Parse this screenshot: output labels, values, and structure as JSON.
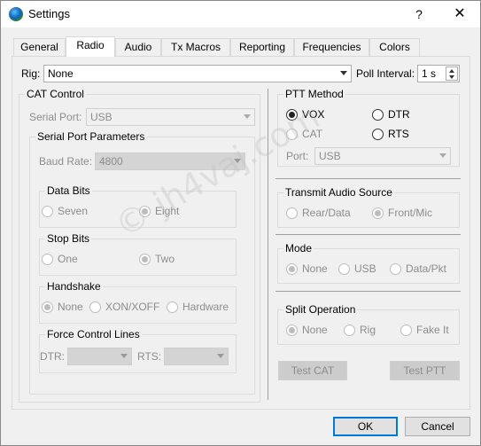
{
  "window": {
    "title": "Settings",
    "help_glyph": "?",
    "close_glyph": "✕"
  },
  "tabs": [
    "General",
    "Radio",
    "Audio",
    "Tx Macros",
    "Reporting",
    "Frequencies",
    "Colors"
  ],
  "active_tab": "Radio",
  "rig": {
    "label": "Rig:",
    "value": "None"
  },
  "poll": {
    "label": "Poll Interval:",
    "value": "1 s"
  },
  "cat": {
    "title": "CAT Control",
    "serial_port_label": "Serial Port:",
    "serial_port_value": "USB",
    "params_title": "Serial Port Parameters",
    "baud_label": "Baud Rate:",
    "baud_value": "4800",
    "data_bits": {
      "title": "Data Bits",
      "options": [
        "Seven",
        "Eight"
      ],
      "selected": "Eight"
    },
    "stop_bits": {
      "title": "Stop Bits",
      "options": [
        "One",
        "Two"
      ],
      "selected": "Two"
    },
    "handshake": {
      "title": "Handshake",
      "options": [
        "None",
        "XON/XOFF",
        "Hardware"
      ],
      "selected": "None"
    },
    "force": {
      "title": "Force Control Lines",
      "dtr_label": "DTR:",
      "rts_label": "RTS:"
    }
  },
  "ptt": {
    "title": "PTT Method",
    "options": [
      "VOX",
      "DTR",
      "CAT",
      "RTS"
    ],
    "selected": "VOX",
    "port_label": "Port:",
    "port_value": "USB"
  },
  "tx_audio": {
    "title": "Transmit Audio Source",
    "options": [
      "Rear/Data",
      "Front/Mic"
    ],
    "selected": "Front/Mic"
  },
  "mode": {
    "title": "Mode",
    "options": [
      "None",
      "USB",
      "Data/Pkt"
    ],
    "selected": "None"
  },
  "split": {
    "title": "Split Operation",
    "options": [
      "None",
      "Rig",
      "Fake It"
    ],
    "selected": "None"
  },
  "buttons": {
    "test_cat": "Test CAT",
    "test_ptt": "Test PTT",
    "ok": "OK",
    "cancel": "Cancel"
  },
  "watermark": "© jh4vaj.com",
  "colors": {
    "accent": "#0078d7",
    "disabled_text": "#8c8c8c"
  }
}
